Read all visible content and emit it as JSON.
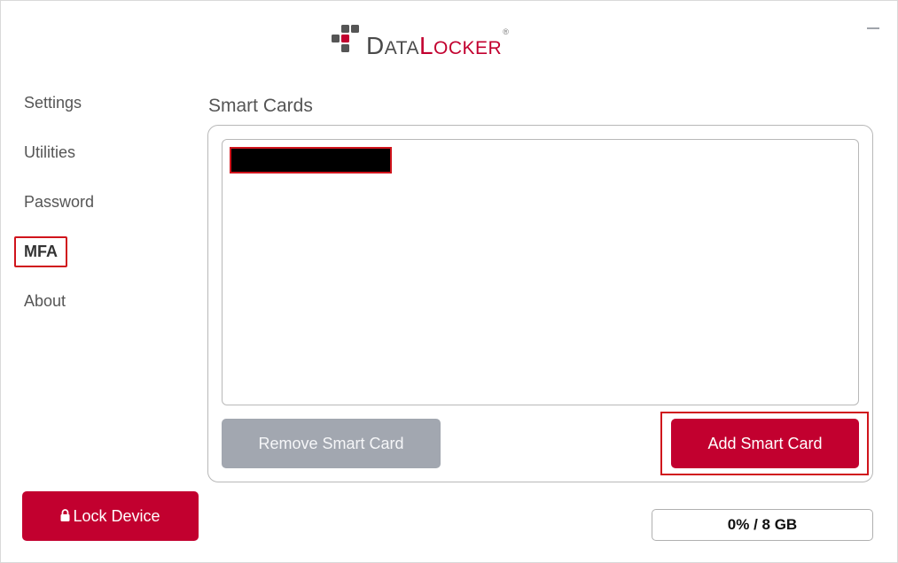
{
  "app": {
    "brand_part1_cap": "D",
    "brand_part1_rest": "ATA",
    "brand_part2_cap": "L",
    "brand_part2_rest": "OCKER",
    "brand_reg": "®"
  },
  "sidebar": {
    "items": [
      {
        "label": "Settings"
      },
      {
        "label": "Utilities"
      },
      {
        "label": "Password"
      },
      {
        "label": "MFA"
      },
      {
        "label": "About"
      }
    ],
    "active": "MFA",
    "lock_button_label": "Lock Device"
  },
  "main": {
    "section_title": "Smart Cards",
    "card_list": [
      {
        "label": ""
      }
    ],
    "remove_button_label": "Remove Smart Card",
    "add_button_label": "Add Smart Card"
  },
  "footer": {
    "storage_usage": "0% / 8 GB"
  },
  "colors": {
    "accent": "#c2002f",
    "disabled_button": "#a2a7b0",
    "highlight_box": "#d0141c"
  },
  "icons": [
    "datalocker-logo",
    "minimize-icon",
    "lock-icon"
  ]
}
